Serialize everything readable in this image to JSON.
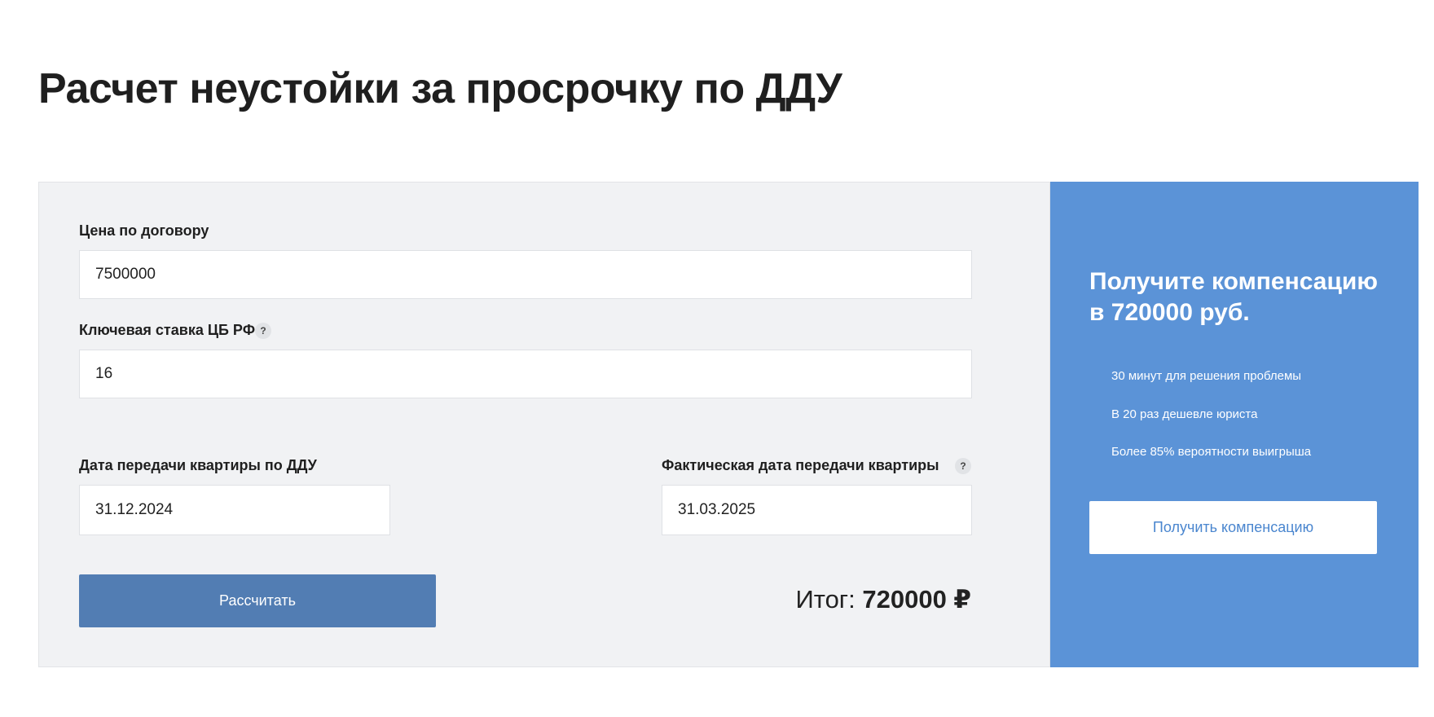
{
  "page": {
    "title": "Расчет неустойки за просрочку по ДДУ"
  },
  "form": {
    "price": {
      "label": "Цена по договору",
      "value": "7500000"
    },
    "rate": {
      "label": "Ключевая ставка ЦБ РФ",
      "help": "?",
      "value": "16"
    },
    "planned_date": {
      "label": "Дата передачи квартиры по ДДУ",
      "value": "31.12.2024"
    },
    "actual_date": {
      "label": "Фактическая дата передачи квартиры",
      "help": "?",
      "value": "31.03.2025"
    },
    "calculate_button": "Рассчитать",
    "total": {
      "label": "Итог:",
      "value": "720000 ₽"
    }
  },
  "promo": {
    "title": "Получите компенсацию в 720000 руб.",
    "benefits": [
      "30 минут для решения проблемы",
      "В 20 раз дешевле юриста",
      "Более 85% вероятности выигрыша"
    ],
    "button": "Получить компенсацию"
  },
  "colors": {
    "card_background": "#f1f2f4",
    "promo_background": "#5b93d7",
    "calc_button": "#527db3",
    "promo_button_text": "#4a86cf"
  }
}
